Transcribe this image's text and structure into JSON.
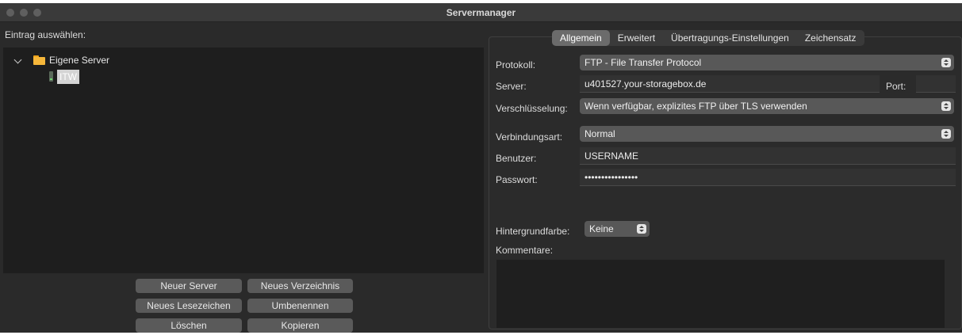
{
  "window": {
    "title": "Servermanager"
  },
  "left": {
    "select_label": "Eintrag auswählen:",
    "tree": {
      "root_label": "Eigene Server",
      "children": [
        {
          "label": "ITW"
        }
      ]
    },
    "buttons": {
      "new_server": "Neuer Server",
      "new_folder": "Neues Verzeichnis",
      "new_bookmark": "Neues Lesezeichen",
      "rename": "Umbenennen",
      "delete": "Löschen",
      "copy": "Kopieren"
    }
  },
  "tabs": [
    {
      "label": "Allgemein",
      "active": true
    },
    {
      "label": "Erweitert",
      "active": false
    },
    {
      "label": "Übertragungs-Einstellungen",
      "active": false
    },
    {
      "label": "Zeichensatz",
      "active": false
    }
  ],
  "form": {
    "protocol": {
      "label": "Protokoll:",
      "value": "FTP - File Transfer Protocol"
    },
    "server": {
      "label": "Server:",
      "value": "u401527.your-storagebox.de"
    },
    "port": {
      "label": "Port:",
      "value": ""
    },
    "encryption": {
      "label": "Verschlüsselung:",
      "value": "Wenn verfügbar, explizites FTP über TLS verwenden"
    },
    "logon_type": {
      "label": "Verbindungsart:",
      "value": "Normal"
    },
    "user": {
      "label": "Benutzer:",
      "value": "USERNAME"
    },
    "password": {
      "label": "Passwort:",
      "value": "••••••••••••••••"
    },
    "background_color": {
      "label": "Hintergrundfarbe:",
      "value": "Keine"
    },
    "comments": {
      "label": "Kommentare:",
      "value": ""
    }
  }
}
